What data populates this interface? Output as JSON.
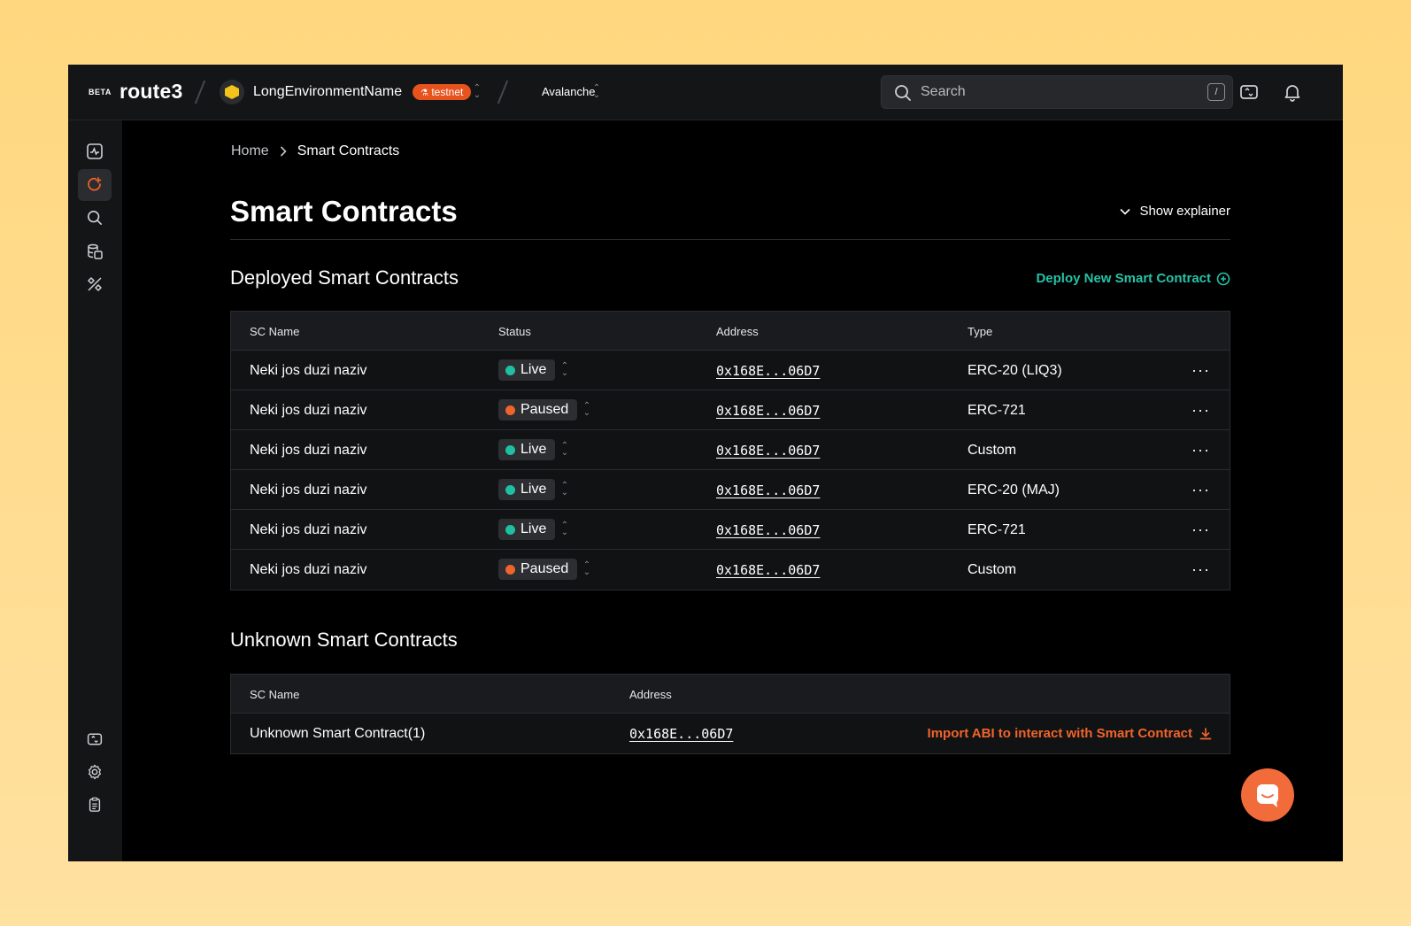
{
  "topbar": {
    "beta_label": "BETA",
    "logo_text": "route3",
    "environment_name": "LongEnvironmentName",
    "environment_badge": "testnet",
    "network": "Avalanche",
    "search_placeholder": "Search",
    "search_shortcut": "/"
  },
  "sidebar": {
    "items": [
      {
        "icon": "activity-icon",
        "active": false
      },
      {
        "icon": "smart-contract-icon",
        "active": true
      },
      {
        "icon": "search-icon",
        "active": false
      },
      {
        "icon": "database-icon",
        "active": false
      },
      {
        "icon": "tools-icon",
        "active": false
      }
    ],
    "bottom_items": [
      {
        "icon": "switch-icon"
      },
      {
        "icon": "gear-icon"
      },
      {
        "icon": "clipboard-icon"
      }
    ]
  },
  "breadcrumb": {
    "home": "Home",
    "current": "Smart Contracts"
  },
  "page": {
    "title": "Smart Contracts",
    "explainer_label": "Show explainer"
  },
  "deployed": {
    "title": "Deployed Smart Contracts",
    "deploy_label": "Deploy New Smart Contract",
    "columns": [
      "SC Name",
      "Status",
      "Address",
      "Type"
    ],
    "rows": [
      {
        "name": "Neki jos duzi naziv",
        "status": "Live",
        "address": "0x168E...06D7",
        "type": "ERC-20 (LIQ3)"
      },
      {
        "name": "Neki jos duzi naziv",
        "status": "Paused",
        "address": "0x168E...06D7",
        "type": "ERC-721"
      },
      {
        "name": "Neki jos duzi naziv",
        "status": "Live",
        "address": "0x168E...06D7",
        "type": "Custom"
      },
      {
        "name": "Neki jos duzi naziv",
        "status": "Live",
        "address": "0x168E...06D7",
        "type": "ERC-20 (MAJ)"
      },
      {
        "name": "Neki jos duzi naziv",
        "status": "Live",
        "address": "0x168E...06D7",
        "type": "ERC-721"
      },
      {
        "name": "Neki jos duzi naziv",
        "status": "Paused",
        "address": "0x168E...06D7",
        "type": "Custom"
      }
    ],
    "more_label": "···"
  },
  "unknown": {
    "title": "Unknown Smart Contracts",
    "columns": [
      "SC Name",
      "Address"
    ],
    "rows": [
      {
        "name": "Unknown Smart Contract(1)",
        "address": "0x168E...06D7",
        "action": "Import ABI to interact with Smart Contract"
      }
    ]
  },
  "colors": {
    "live": "#1fbfa3",
    "paused": "#f0642b",
    "accent_teal": "#25c3a8",
    "accent_orange": "#f0642b"
  }
}
